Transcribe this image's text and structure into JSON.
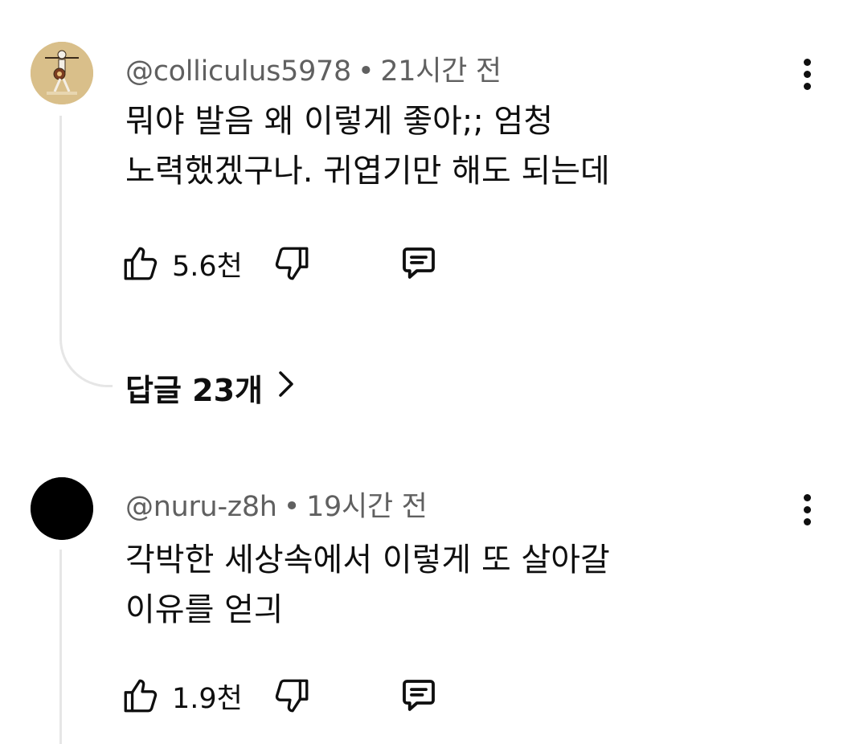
{
  "comments": [
    {
      "author": "@colliculus5978",
      "separator": "•",
      "time": "21시간 전",
      "lines": [
        "뭐야 발음 왜 이렇게 좋아;; 엄청",
        "노력했겠구나. 귀엽기만 해도 되는데"
      ],
      "likes": "5.6천",
      "replies_label": "답글 23개",
      "avatar_icon": "skeleton-figure-avatar"
    },
    {
      "author": "@nuru-z8h",
      "separator": "•",
      "time": "19시간 전",
      "lines": [
        "각박한 세상속에서 이렇게 또 살아갈",
        "이유를 얻긔"
      ],
      "likes": "1.9천",
      "avatar_icon": "black-circle-avatar"
    }
  ],
  "icons": {
    "like": "thumbs-up-icon",
    "dislike": "thumbs-down-icon",
    "reply": "comment-icon",
    "more": "more-vertical-icon",
    "chevron": "chevron-right-icon"
  },
  "colors": {
    "text": "#0f0f0f",
    "meta": "#606060",
    "thread_line": "#e6e6e6",
    "avatar1_bg": "#d9bf8a",
    "avatar2_bg": "#000000"
  }
}
